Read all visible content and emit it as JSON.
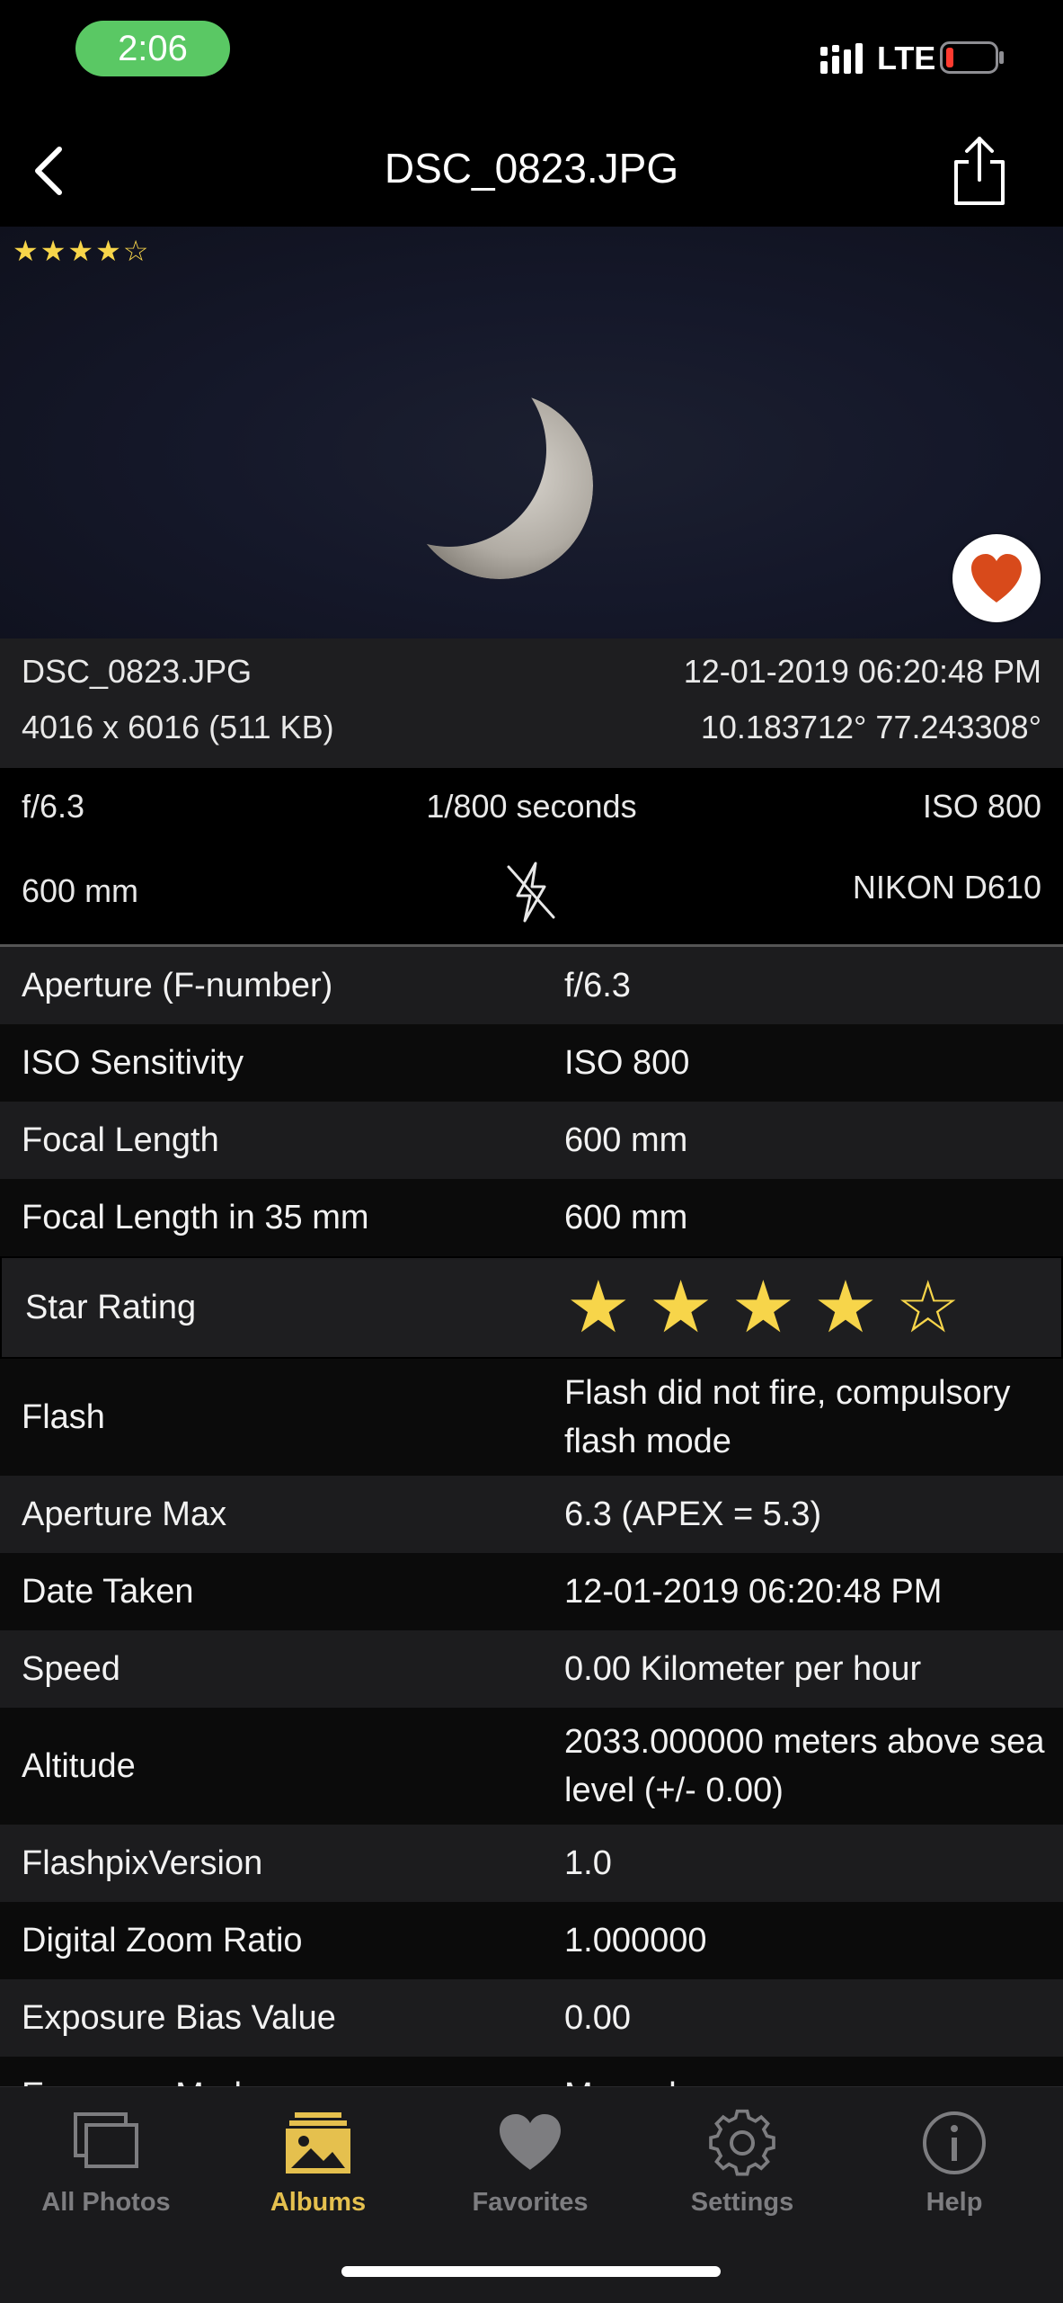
{
  "status_bar": {
    "time": "2:06",
    "network": "LTE"
  },
  "nav": {
    "title": "DSC_0823.JPG"
  },
  "photo": {
    "rating_stars": "★★★★☆",
    "rating": 4,
    "rating_max": 5
  },
  "info": {
    "filename": "DSC_0823.JPG",
    "datetime": "12-01-2019 06:20:48 PM",
    "dimensions": "4016 x 6016 (511 KB)",
    "coordinates": "10.183712° 77.243308°"
  },
  "quick": {
    "aperture": "f/6.3",
    "shutter": "1/800 seconds",
    "iso": "ISO 800",
    "focal": "600 mm",
    "camera": "NIKON D610"
  },
  "details": [
    {
      "label": "Aperture (F-number)",
      "value": "f/6.3"
    },
    {
      "label": "ISO Sensitivity",
      "value": "ISO 800"
    },
    {
      "label": "Focal Length",
      "value": "600 mm"
    },
    {
      "label": "Focal Length in 35 mm",
      "value": "600 mm"
    },
    {
      "label": "Star Rating",
      "value": ""
    },
    {
      "label": "Flash",
      "value": "Flash did not fire, compulsory flash mode"
    },
    {
      "label": "Aperture Max",
      "value": "6.3 (APEX = 5.3)"
    },
    {
      "label": "Date Taken",
      "value": "12-01-2019 06:20:48 PM"
    },
    {
      "label": "Speed",
      "value": "0.00 Kilometer per hour"
    },
    {
      "label": "Altitude",
      "value": "2033.000000 meters above sea level (+/- 0.00)"
    },
    {
      "label": "FlashpixVersion",
      "value": "1.0"
    },
    {
      "label": "Digital Zoom Ratio",
      "value": "1.000000"
    },
    {
      "label": "Exposure Bias Value",
      "value": "0.00"
    },
    {
      "label": "Exposure Mode",
      "value": "Manual"
    }
  ],
  "tabs": [
    {
      "label": "All Photos",
      "icon": "photos-icon"
    },
    {
      "label": "Albums",
      "icon": "albums-icon"
    },
    {
      "label": "Favorites",
      "icon": "heart-icon"
    },
    {
      "label": "Settings",
      "icon": "gear-icon"
    },
    {
      "label": "Help",
      "icon": "info-icon"
    }
  ],
  "active_tab": "Albums",
  "colors": {
    "accent": "#e5c04e",
    "star": "#f7d54a",
    "heart": "#d84a1b",
    "status_pill": "#5ac864"
  }
}
